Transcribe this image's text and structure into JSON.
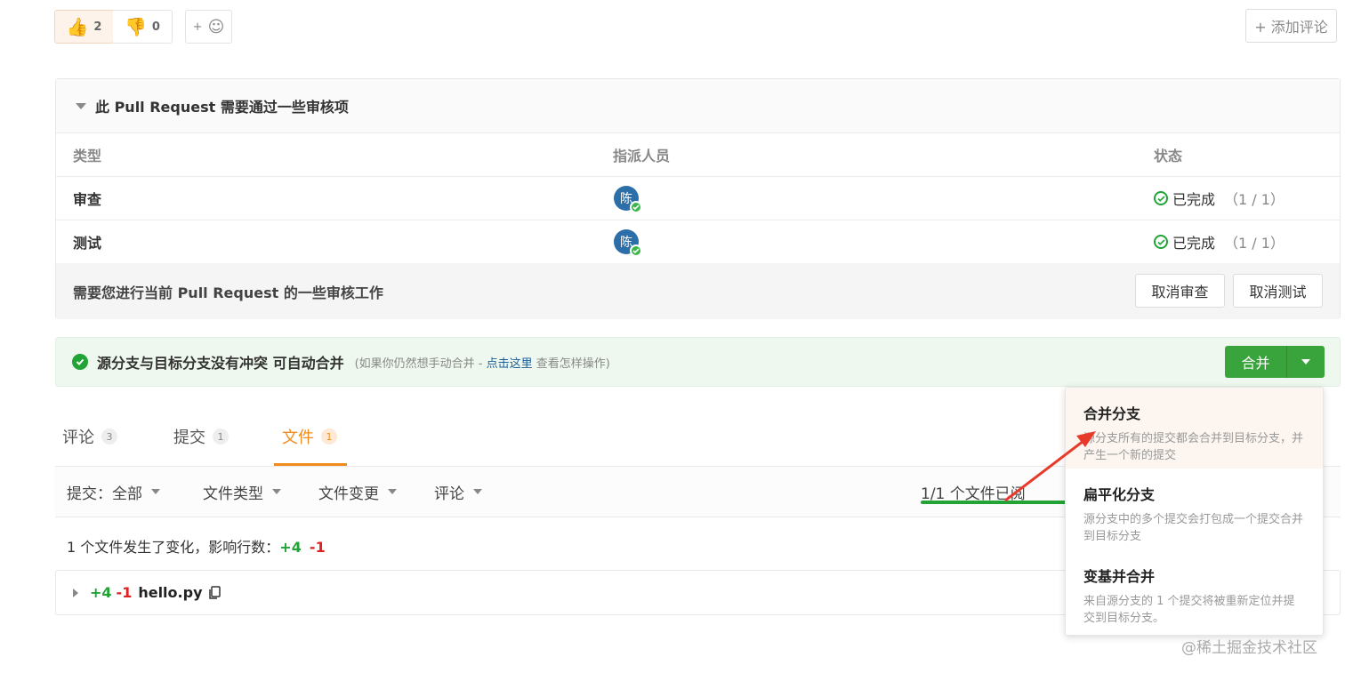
{
  "reactions": {
    "thumbs_up_count": "2",
    "thumbs_down_count": "0",
    "add_emoji_label": "+"
  },
  "add_comment": "+ 添加评论",
  "review": {
    "title": "此 Pull Request 需要通过一些审核项",
    "headers": {
      "type": "类型",
      "assignee": "指派人员",
      "status": "状态"
    },
    "rows": [
      {
        "type": "审查",
        "avatar": "陈",
        "status": "已完成",
        "progress": "（1 / 1）"
      },
      {
        "type": "测试",
        "avatar": "陈",
        "status": "已完成",
        "progress": "（1 / 1）"
      }
    ],
    "footer_text": "需要您进行当前 Pull Request 的一些审核工作",
    "cancel_review": "取消审查",
    "cancel_test": "取消测试"
  },
  "merge_status": {
    "text": "源分支与目标分支没有冲突 可自动合并",
    "hint_prefix": "(如果你仍然想手动合并 - ",
    "hint_link": "点击这里",
    "hint_suffix": " 查看怎样操作)",
    "merge_button": "合并"
  },
  "tabs": [
    {
      "label": "评论",
      "count": "3"
    },
    {
      "label": "提交",
      "count": "1"
    },
    {
      "label": "文件",
      "count": "1",
      "active": true
    }
  ],
  "filters": [
    "提交：全部",
    "文件类型",
    "文件变更",
    "评论"
  ],
  "files_viewed": "1/1 个文件已阅",
  "summary": {
    "prefix": "1 个文件发生了变化，影响行数：",
    "added": "+4",
    "removed": "-1"
  },
  "file": {
    "added": "+4",
    "removed": "-1",
    "name": "hello.py"
  },
  "merge_menu": [
    {
      "title": "合并分支",
      "desc": "源分支所有的提交都会合并到目标分支，并产生一个新的提交"
    },
    {
      "title": "扁平化分支",
      "desc": "源分支中的多个提交会打包成一个提交合并到目标分支"
    },
    {
      "title": "变基并合并",
      "desc": "来自源分支的 1 个提交将被重新定位并提交到目标分支。"
    }
  ],
  "watermark": "@稀土掘金技术社区",
  "colors": {
    "accent_orange": "#f08c1e",
    "success_green": "#21a336",
    "merge_button": "#3aa43c",
    "removed_red": "#e02020",
    "annotation_red": "#e83a2a"
  }
}
